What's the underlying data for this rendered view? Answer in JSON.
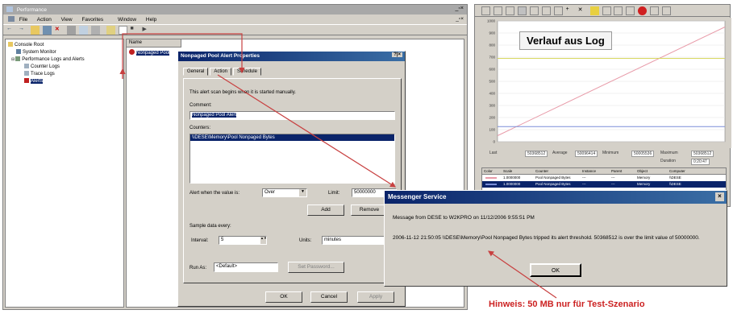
{
  "perf_window": {
    "title": "Performance",
    "menu": [
      "File",
      "Action",
      "View",
      "Favorites",
      "Window",
      "Help"
    ],
    "tree": [
      {
        "label": "Console Root",
        "level": 0
      },
      {
        "label": "System Monitor",
        "level": 1
      },
      {
        "label": "Performance Logs and Alerts",
        "level": 1
      },
      {
        "label": "Counter Logs",
        "level": 2
      },
      {
        "label": "Trace Logs",
        "level": 2
      },
      {
        "label": "Alerts",
        "level": 2
      }
    ],
    "list_header": "Name",
    "list_item": "Nonpaged Pool"
  },
  "alert_dialog": {
    "title": "Nonpaged Pool Alert Properties",
    "tabs": [
      "General",
      "Action",
      "Schedule"
    ],
    "scan_text": "This alert scan begins when it is started manually.",
    "comment_label": "Comment:",
    "comment_value": "Nonpaged Pool Alert",
    "counters_label": "Counters:",
    "counter_value": "\\\\DESE\\Memory\\Pool Nonpaged Bytes",
    "alert_when_label": "Alert when the value is:",
    "alert_when_value": "Over",
    "limit_label": "Limit:",
    "limit_value": "50000000",
    "add_label": "Add",
    "remove_label": "Remove",
    "sample_label": "Sample data every:",
    "interval_label": "Interval:",
    "interval_value": "5",
    "units_label": "Units:",
    "units_value": "minutes",
    "runas_label": "Run As:",
    "runas_value": "<Default>",
    "password_label": "Set Password...",
    "ok_label": "OK",
    "cancel_label": "Cancel",
    "apply_label": "Apply"
  },
  "messenger": {
    "title": "Messenger Service",
    "line1": "Message from DESE to W2KPRO on 11/12/2006 9:55:51 PM",
    "line2": "2006-11-12 21:50:05 \\\\DESE\\Memory\\Pool Nonpaged Bytes tripped its alert threshold. 50368512 is over the limit value of 50000000.",
    "ok_label": "OK",
    "close_label": "×"
  },
  "chart_window": {
    "caption": "Verlauf aus Log",
    "stats": [
      "Last",
      "50368512",
      "Average",
      "50096414",
      "Minimum",
      "50005536",
      "Maximum",
      "50368512",
      "Duration",
      "0:20:47"
    ],
    "table_headers": [
      "Color",
      "Scale",
      "Counter",
      "Instance",
      "Parent",
      "Object",
      "Computer"
    ],
    "table_rows": [
      [
        "1.0000000",
        "Pool Nonpaged Bytes",
        "---",
        "---",
        "Memory",
        "\\\\DESE"
      ],
      [
        "1.0000000",
        "Pool Nonpaged Bytes",
        "---",
        "---",
        "Memory",
        "\\\\DESE"
      ]
    ]
  },
  "chart_data": {
    "type": "line",
    "title": "",
    "ylim": [
      0,
      1000
    ],
    "y_ticks": [
      "1000",
      "900",
      "800",
      "700",
      "600",
      "500",
      "400",
      "300",
      "200",
      "100",
      "0"
    ],
    "series": [
      {
        "color": "#e89aa8",
        "values": [
          50,
          950
        ]
      },
      {
        "color": "#d8d860",
        "values": [
          690,
          690
        ]
      },
      {
        "color": "#7a8ed8",
        "values": [
          125,
          125
        ]
      }
    ]
  },
  "hint": "Hinweis: 50 MB nur für Test-Szenario",
  "colors": {
    "hint": "#cc2222",
    "arrow": "#c84040"
  }
}
